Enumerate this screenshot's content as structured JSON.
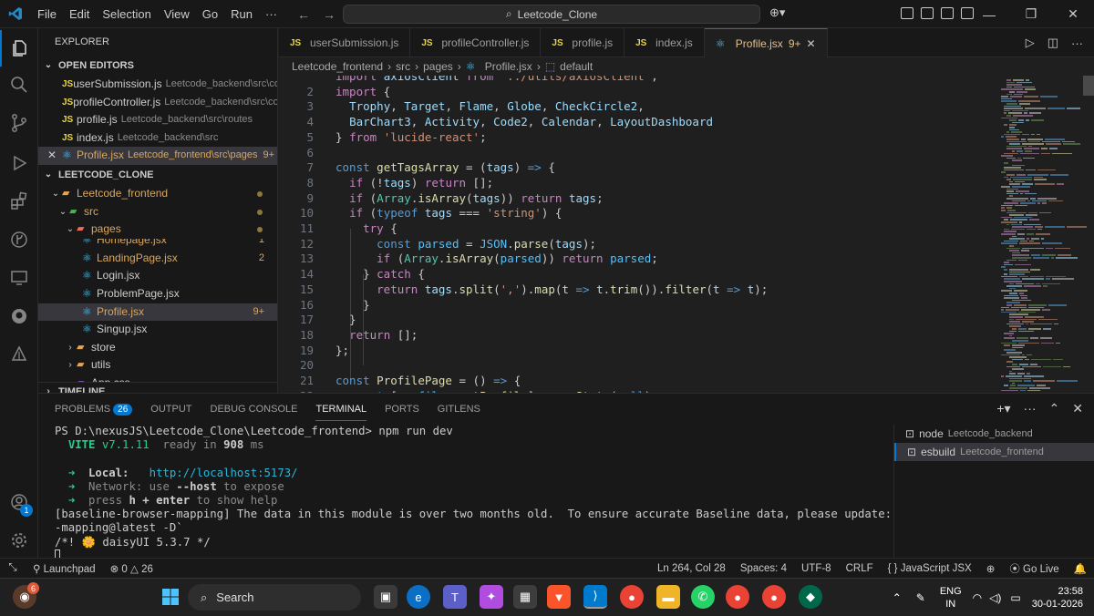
{
  "titlebar": {
    "menu": [
      "File",
      "Edit",
      "Selection",
      "View",
      "Go",
      "Run",
      "···"
    ],
    "search_text": "Leetcode_Clone"
  },
  "activity": {
    "account_badge": "1"
  },
  "sidebar": {
    "title": "EXPLORER",
    "open_editors_label": "OPEN EDITORS",
    "open_editors": [
      {
        "name": "userSubmission.js",
        "path": "Leetcode_backend\\src\\co...",
        "type": "js"
      },
      {
        "name": "profileController.js",
        "path": "Leetcode_backend\\src\\co...",
        "type": "js"
      },
      {
        "name": "profile.js",
        "path": "Leetcode_backend\\src\\routes",
        "type": "js"
      },
      {
        "name": "index.js",
        "path": "Leetcode_backend\\src",
        "type": "js"
      },
      {
        "name": "Profile.jsx",
        "path": "Leetcode_frontend\\src\\pages",
        "type": "jsx",
        "count": "9+"
      }
    ],
    "project_label": "LEETCODE_CLONE",
    "tree": {
      "frontend": "Leetcode_frontend",
      "src": "src",
      "pages": "pages",
      "files": [
        {
          "name": "Homepage.jsx",
          "count": "1"
        },
        {
          "name": "LandingPage.jsx",
          "count": "2"
        },
        {
          "name": "Login.jsx",
          "count": ""
        },
        {
          "name": "ProblemPage.jsx",
          "count": ""
        },
        {
          "name": "Profile.jsx",
          "count": "9+"
        },
        {
          "name": "Singup.jsx",
          "count": ""
        }
      ],
      "store": "store",
      "utils": "utils",
      "app_css": "App.css"
    },
    "timeline_label": "TIMELINE"
  },
  "tabs": [
    {
      "name": "userSubmission.js",
      "type": "js"
    },
    {
      "name": "profileController.js",
      "type": "js"
    },
    {
      "name": "profile.js",
      "type": "js"
    },
    {
      "name": "index.js",
      "type": "js"
    },
    {
      "name": "Profile.jsx",
      "type": "jsx",
      "count": "9+"
    }
  ],
  "breadcrumb": [
    "Leetcode_frontend",
    "src",
    "pages",
    "Profile.jsx",
    "default"
  ],
  "editor": {
    "lines": [
      {
        "n": "",
        "html": "<span class='k'>import</span> <span class='v'>axiosClient</span> <span class='k'>from</span> <span class='s'>'../utils/axiosClient'</span>;"
      },
      {
        "n": "2",
        "html": "<span class='k'>import</span> {"
      },
      {
        "n": "3",
        "html": "  <span class='v'>Trophy</span>, <span class='v'>Target</span>, <span class='v'>Flame</span>, <span class='v'>Globe</span>, <span class='v'>CheckCircle2</span>,"
      },
      {
        "n": "4",
        "html": "  <span class='v'>BarChart3</span>, <span class='v'>Activity</span>, <span class='v'>Code2</span>, <span class='v'>Calendar</span>, <span class='v'>LayoutDashboard</span>"
      },
      {
        "n": "5",
        "html": "} <span class='k'>from</span> <span class='s'>'lucide-react'</span>;"
      },
      {
        "n": "6",
        "html": ""
      },
      {
        "n": "7",
        "html": "<span class='kb'>const</span> <span class='f'>getTagsArray</span> = (<span class='v'>tags</span>) <span class='kb'>=&gt;</span> {"
      },
      {
        "n": "8",
        "html": "  <span class='k'>if</span> (!<span class='v'>tags</span>) <span class='k'>return</span> [];"
      },
      {
        "n": "9",
        "html": "  <span class='k'>if</span> (<span class='t'>Array</span>.<span class='f'>isArray</span>(<span class='v'>tags</span>)) <span class='k'>return</span> <span class='v'>tags</span>;"
      },
      {
        "n": "10",
        "html": "  <span class='k'>if</span> (<span class='kb'>typeof</span> <span class='v'>tags</span> === <span class='s'>'string'</span>) {"
      },
      {
        "n": "11",
        "html": "    <span class='k'>try</span> {"
      },
      {
        "n": "12",
        "html": "      <span class='kb'>const</span> <span class='c'>parsed</span> = <span class='c'>JSON</span>.<span class='f'>parse</span>(<span class='v'>tags</span>);"
      },
      {
        "n": "13",
        "html": "      <span class='k'>if</span> (<span class='t'>Array</span>.<span class='f'>isArray</span>(<span class='c'>parsed</span>)) <span class='k'>return</span> <span class='c'>parsed</span>;"
      },
      {
        "n": "14",
        "html": "    } <span class='k'>catch</span> {"
      },
      {
        "n": "15",
        "html": "      <span class='k'>return</span> <span class='v'>tags</span>.<span class='f'>split</span>(<span class='s'>','</span>).<span class='f'>map</span>(<span class='v'>t</span> <span class='kb'>=&gt;</span> <span class='v'>t</span>.<span class='f'>trim</span>()).<span class='f'>filter</span>(<span class='v'>t</span> <span class='kb'>=&gt;</span> <span class='v'>t</span>);"
      },
      {
        "n": "16",
        "html": "    }"
      },
      {
        "n": "17",
        "html": "  }"
      },
      {
        "n": "18",
        "html": "  <span class='k'>return</span> [];"
      },
      {
        "n": "19",
        "html": "};"
      },
      {
        "n": "20",
        "html": ""
      },
      {
        "n": "21",
        "html": "<span class='kb'>const</span> <span class='f'>ProfilePage</span> = () <span class='kb'>=&gt;</span> {"
      },
      {
        "n": "22",
        "html": "  <span class='kb'>const</span> [<span class='c'>profile</span>, <span class='f'>setProfile</span>] = <span class='f'>useState</span>(<span class='kb'>null</span>);"
      }
    ]
  },
  "panel": {
    "tabs": [
      {
        "label": "PROBLEMS",
        "badge": "26"
      },
      {
        "label": "OUTPUT",
        "badge": ""
      },
      {
        "label": "DEBUG CONSOLE",
        "badge": ""
      },
      {
        "label": "TERMINAL",
        "badge": "",
        "active": true
      },
      {
        "label": "PORTS",
        "badge": ""
      },
      {
        "label": "GITLENS",
        "badge": ""
      }
    ],
    "terminal": {
      "prompt": "PS D:\\nexusJS\\Leetcode_Clone\\Leetcode_frontend> npm run dev",
      "vite_name": "VITE",
      "vite_version": "v7.1.11",
      "ready_prefix": "ready in",
      "ready_ms": "908",
      "ready_unit": "ms",
      "local_label": "Local:",
      "local_url": "http://localhost:5173/",
      "network_label": "Network:",
      "network_text": "use",
      "network_flag": "--host",
      "network_suffix": "to expose",
      "help_prefix": "press",
      "help_key": "h + enter",
      "help_suffix": "to show help",
      "baseline_1": "[baseline-browser-mapping] The data in this module is over two months old.  To ensure accurate Baseline data, please update: `npm i baseline-browser",
      "baseline_2": "-mapping@latest -D`",
      "daisy": "/*! 🌼 daisyUI 5.3.7 */"
    },
    "terminals": [
      {
        "name": "node",
        "sub": "Leetcode_backend"
      },
      {
        "name": "esbuild",
        "sub": "Leetcode_frontend"
      }
    ]
  },
  "status": {
    "launchpad": "Launchpad",
    "errors": "0",
    "warnings": "26",
    "position": "Ln 264, Col 28",
    "spaces": "Spaces: 4",
    "encoding": "UTF-8",
    "eol": "CRLF",
    "language": "JavaScript JSX",
    "golive": "Go Live"
  },
  "taskbar": {
    "notif_badge": "6",
    "search_label": "Search",
    "lang": "ENG",
    "region": "IN",
    "time": "23:58",
    "date": "30-01-2026"
  },
  "colors": {
    "accent": "#0078d4",
    "warning": "#d9a760",
    "bg": "#1f1f1f"
  }
}
